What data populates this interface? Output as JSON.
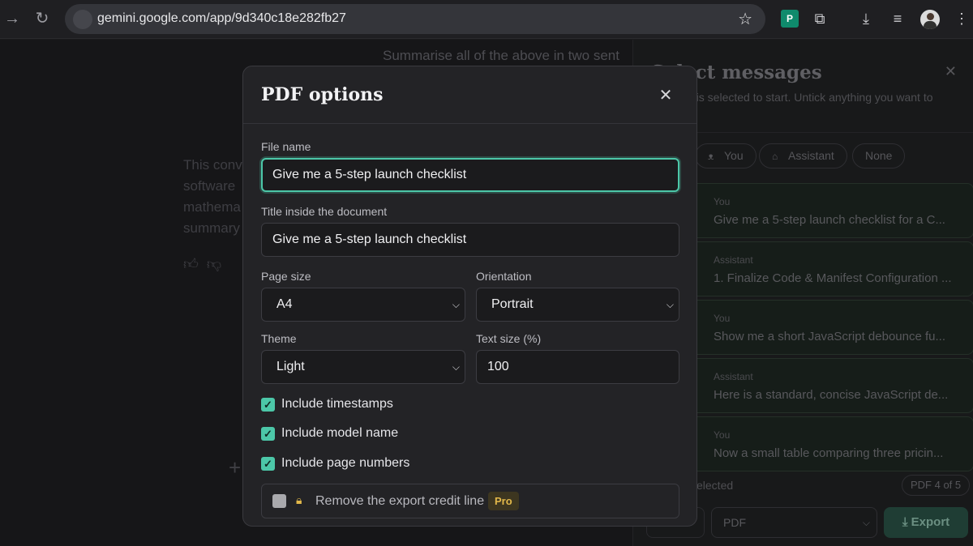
{
  "browser": {
    "url": "gemini.google.com/app/9d340c18e282fb27"
  },
  "background": {
    "prompt_text": "Summarise all of the above in two sent",
    "para_lines": [
      "This conv",
      "software",
      "mathema",
      "summary"
    ]
  },
  "panel": {
    "title": "Select messages",
    "subtitle": "g is selected to start. Untick anything you want to",
    "chips": [
      "You",
      "Assistant",
      "None"
    ],
    "messages": [
      {
        "role": "You",
        "text": "Give me a 5-step launch checklist for a C..."
      },
      {
        "role": "Assistant",
        "text": "1. Finalize Code & Manifest Configuration ..."
      },
      {
        "role": "You",
        "text": "Show me a short JavaScript debounce fu..."
      },
      {
        "role": "Assistant",
        "text": "Here is a standard, concise JavaScript de..."
      },
      {
        "role": "You",
        "text": "Now a small table comparing three pricin..."
      }
    ],
    "selected_label": "elected",
    "page_badge": "PDF 4 of 5",
    "format_value": "PDF",
    "export_label": "Export"
  },
  "modal": {
    "title": "PDF options",
    "file_name_label": "File name",
    "file_name_value": "Give me a 5-step launch checklist",
    "doc_title_label": "Title inside the document",
    "doc_title_value": "Give me a 5-step launch checklist",
    "page_size_label": "Page size",
    "page_size_value": "A4",
    "orientation_label": "Orientation",
    "orientation_value": "Portrait",
    "theme_label": "Theme",
    "theme_value": "Light",
    "text_size_label": "Text size (%)",
    "text_size_value": "100",
    "checks": [
      {
        "label": "Include timestamps",
        "checked": true
      },
      {
        "label": "Include model name",
        "checked": true
      },
      {
        "label": "Include page numbers",
        "checked": true
      }
    ],
    "credit_label": "Remove the export credit line",
    "pro_badge": "Pro"
  },
  "colors": {
    "accent": "#4cc7a8",
    "pro_gold": "#e2b84a"
  }
}
